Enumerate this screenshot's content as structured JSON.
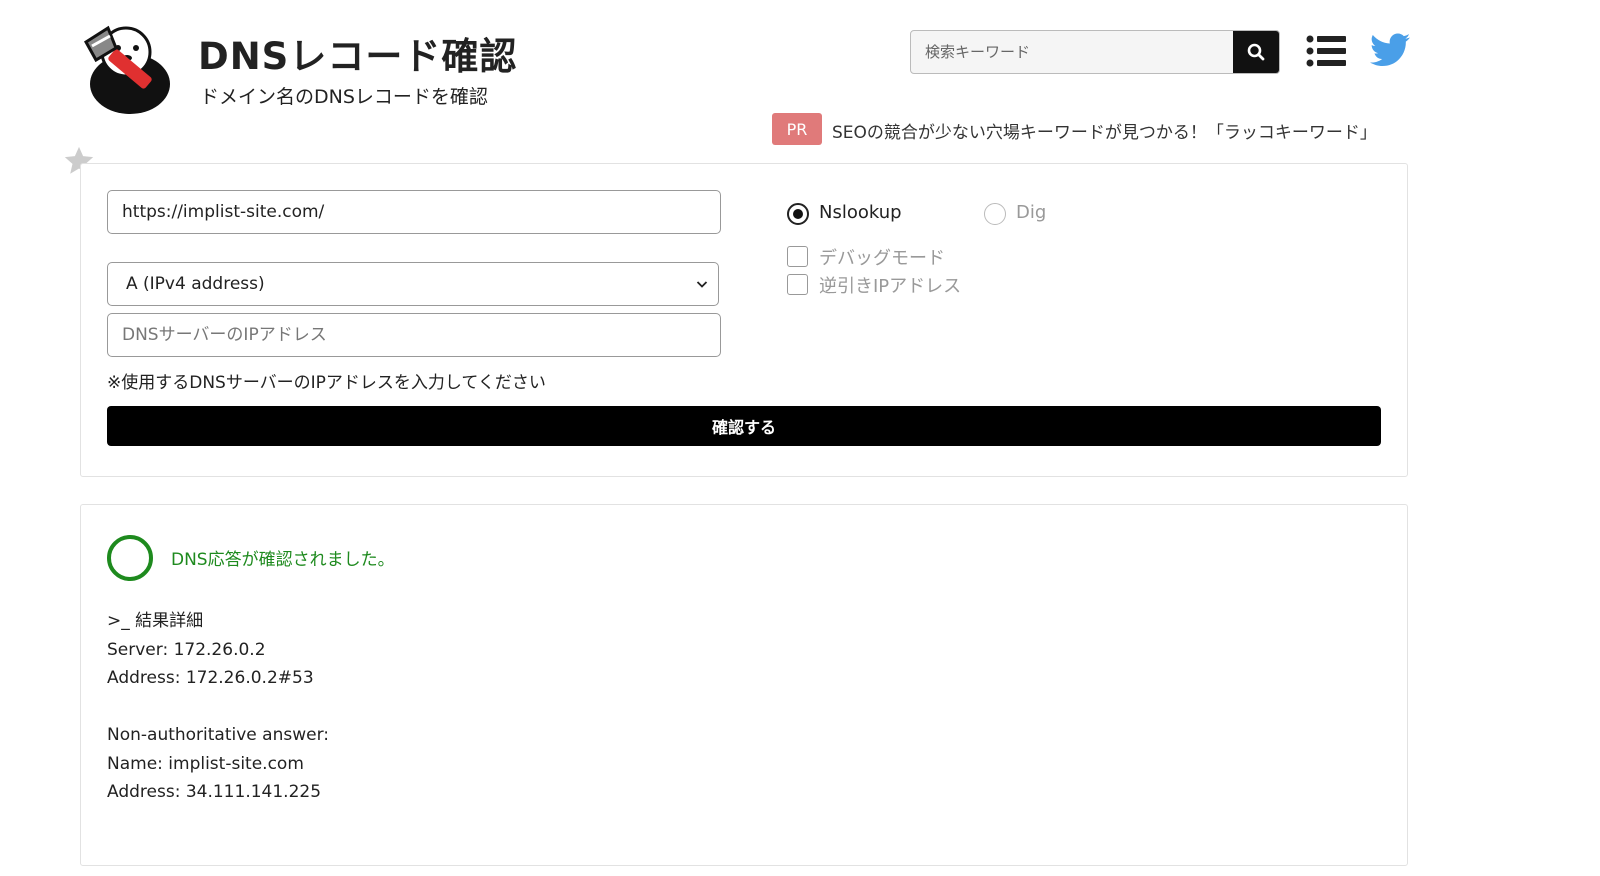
{
  "header": {
    "title": "DNSレコード確認",
    "subtitle": "ドメイン名のDNSレコードを確認",
    "search_placeholder": "検索キーワード"
  },
  "promo": {
    "badge": "PR",
    "text": "SEOの競合が少ない穴場キーワードが見つかる！「ラッコキーワード」"
  },
  "form": {
    "url_value": "https://implist-site.com/",
    "record_type": "A (IPv4 address)",
    "dns_server_placeholder": "DNSサーバーのIPアドレス",
    "note": "※使用するDNSサーバーのIPアドレスを入力してください",
    "submit_label": "確認する",
    "tools": [
      {
        "label": "Nslookup",
        "checked": true
      },
      {
        "label": "Dig",
        "checked": false
      }
    ],
    "options": [
      {
        "label": "デバッグモード",
        "checked": false
      },
      {
        "label": "逆引きIPアドレス",
        "checked": false
      }
    ]
  },
  "result": {
    "status": "DNS応答が確認されました。",
    "lines": [
      ">_ 結果詳細",
      "Server: 172.26.0.2",
      "Address: 172.26.0.2#53",
      "",
      "Non-authoritative answer:",
      "Name: implist-site.com",
      "Address: 34.111.141.225"
    ]
  },
  "colors": {
    "success": "#1e8a1e",
    "pr_badge": "#e07a7a",
    "twitter": "#4a9fe8",
    "button": "#000000"
  }
}
